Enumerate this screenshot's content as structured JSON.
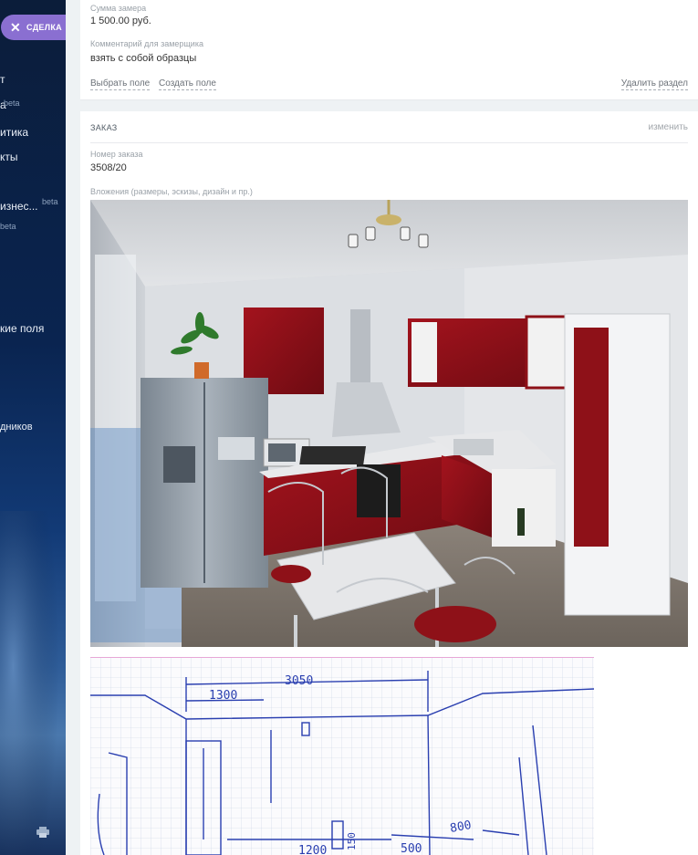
{
  "sidebar": {
    "items": [
      {
        "id": "item-1",
        "label": "т"
      },
      {
        "id": "item-2",
        "label": "а"
      },
      {
        "id": "item-3",
        "label": "итика"
      },
      {
        "id": "item-4",
        "label": "кты"
      },
      {
        "id": "item-5",
        "label": "изнес..."
      },
      {
        "id": "item-6",
        "label": "кие поля"
      },
      {
        "id": "item-7",
        "label": "дников"
      }
    ],
    "beta_labels": [
      "beta",
      "beta",
      "beta"
    ],
    "print_icon": "printer-icon"
  },
  "deal_pill": {
    "label": "СДЕЛКА",
    "icon": "close-icon"
  },
  "top_section": {
    "fields": [
      {
        "label": "Сумма замера",
        "value": "1 500.00 руб."
      },
      {
        "label": "Комментарий для замерщика",
        "value": "взять с собой образцы"
      }
    ],
    "links": {
      "select_field": "Выбрать поле",
      "create_field": "Создать поле",
      "delete_section": "Удалить раздел"
    }
  },
  "order_section": {
    "title": "ЗАКАЗ",
    "edit_label": "изменить",
    "fields": [
      {
        "label": "Номер заказа",
        "value": "3508/20"
      }
    ],
    "attachments_label": "Вложения (размеры, эскизы, дизайн и пр.)",
    "sketch_dimensions": [
      "3050",
      "1300",
      "500",
      "800",
      "1200",
      "150"
    ]
  },
  "colors": {
    "accent": "#8a6fd1",
    "sidebar_bg": "#0b1d3a",
    "cabinet_red": "#8e1118"
  }
}
